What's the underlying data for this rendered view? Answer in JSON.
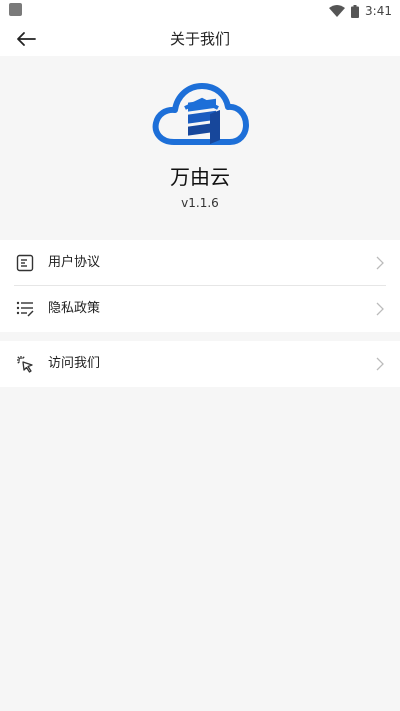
{
  "status_bar": {
    "time": "3:41"
  },
  "header": {
    "title": "关于我们",
    "back_icon": "arrow-left-icon"
  },
  "about": {
    "app_name": "万由云",
    "version": "v1.1.6",
    "logo_icon": "cloud-logo-icon"
  },
  "menu": {
    "group1": [
      {
        "label": "用户协议",
        "icon": "document-icon"
      },
      {
        "label": "隐私政策",
        "icon": "list-icon"
      }
    ],
    "group2": [
      {
        "label": "访问我们",
        "icon": "cursor-click-icon"
      }
    ]
  },
  "colors": {
    "accent": "#1d6fd8",
    "accent_dark": "#17479b",
    "background": "#f6f6f6"
  }
}
